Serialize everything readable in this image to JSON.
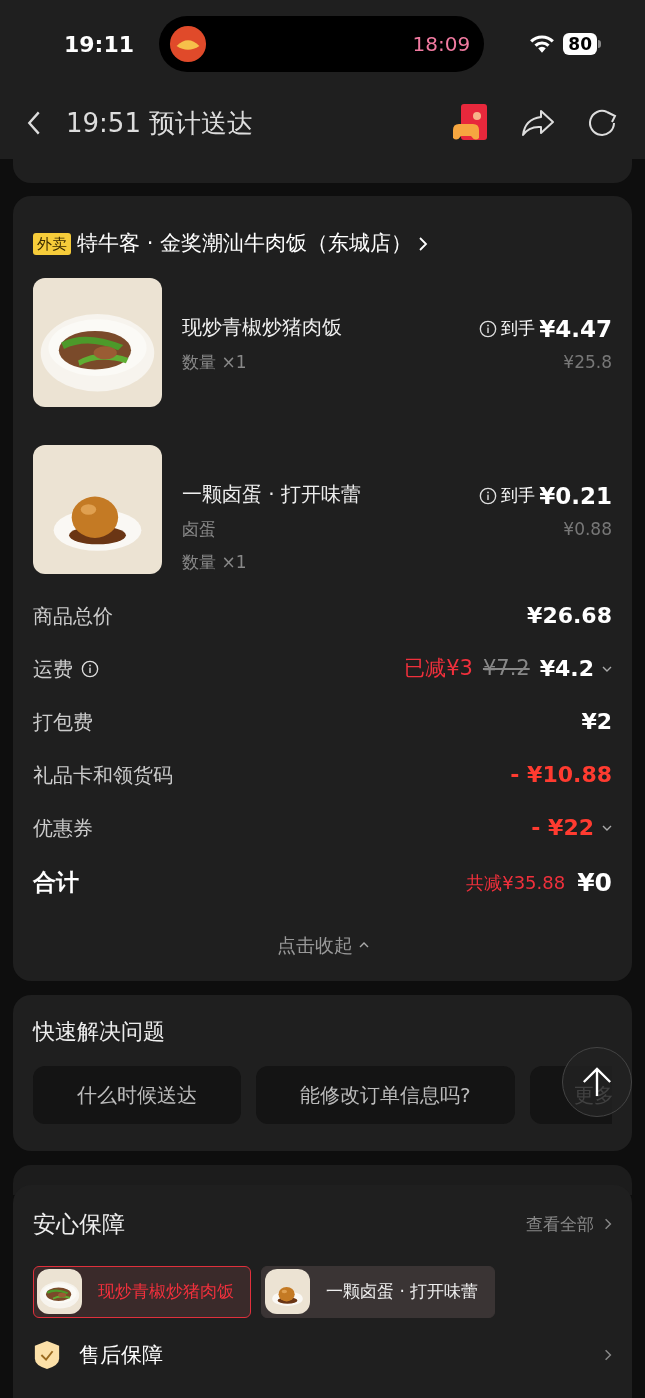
{
  "status_bar": {
    "time": "19:11",
    "island_time": "18:09",
    "battery": "80"
  },
  "nav": {
    "title": "19:51 预计送达"
  },
  "store": {
    "tag": "外卖",
    "name": "特牛客 · 金奖潮汕牛肉饭（东城店）"
  },
  "items": [
    {
      "name": "现炒青椒炒猪肉饭",
      "qty": "数量 ×1",
      "net_label": "到手",
      "net_price": "¥4.47",
      "price": "¥25.8",
      "kind": "rice"
    },
    {
      "name": "一颗卤蛋 · 打开味蕾",
      "spec": "卤蛋",
      "qty": "数量 ×1",
      "net_label": "到手",
      "net_price": "¥0.21",
      "price": "¥0.88",
      "kind": "egg"
    }
  ],
  "fees": [
    {
      "label": "商品总价",
      "info": false,
      "value": "¥26.68",
      "red": false,
      "dropdown": false
    },
    {
      "label": "运费",
      "info": true,
      "discount": "已减¥3",
      "original": "¥7.2",
      "value": "¥4.2",
      "red": false,
      "dropdown": true
    },
    {
      "label": "打包费",
      "info": false,
      "value": "¥2",
      "red": false,
      "dropdown": false
    },
    {
      "label": "礼品卡和领货码",
      "info": false,
      "value": "- ¥10.88",
      "red": true,
      "dropdown": false
    },
    {
      "label": "优惠券",
      "info": false,
      "value": "- ¥22",
      "red": true,
      "dropdown": true
    }
  ],
  "total": {
    "label": "合计",
    "saved": "共减¥35.88",
    "value": "¥0"
  },
  "collapse": "点击收起",
  "quick": {
    "title": "快速解决问题",
    "questions": [
      "什么时候送达",
      "能修改订单信息吗?",
      "更多"
    ]
  },
  "guarantee": {
    "title": "安心保障",
    "view_all": "查看全部",
    "chips": [
      {
        "name": "现炒青椒炒猪肉饭",
        "selected": true,
        "kind": "rice"
      },
      {
        "name": "一颗卤蛋 · 打开味蕾",
        "selected": false,
        "kind": "egg"
      }
    ],
    "row": "售后保障"
  }
}
